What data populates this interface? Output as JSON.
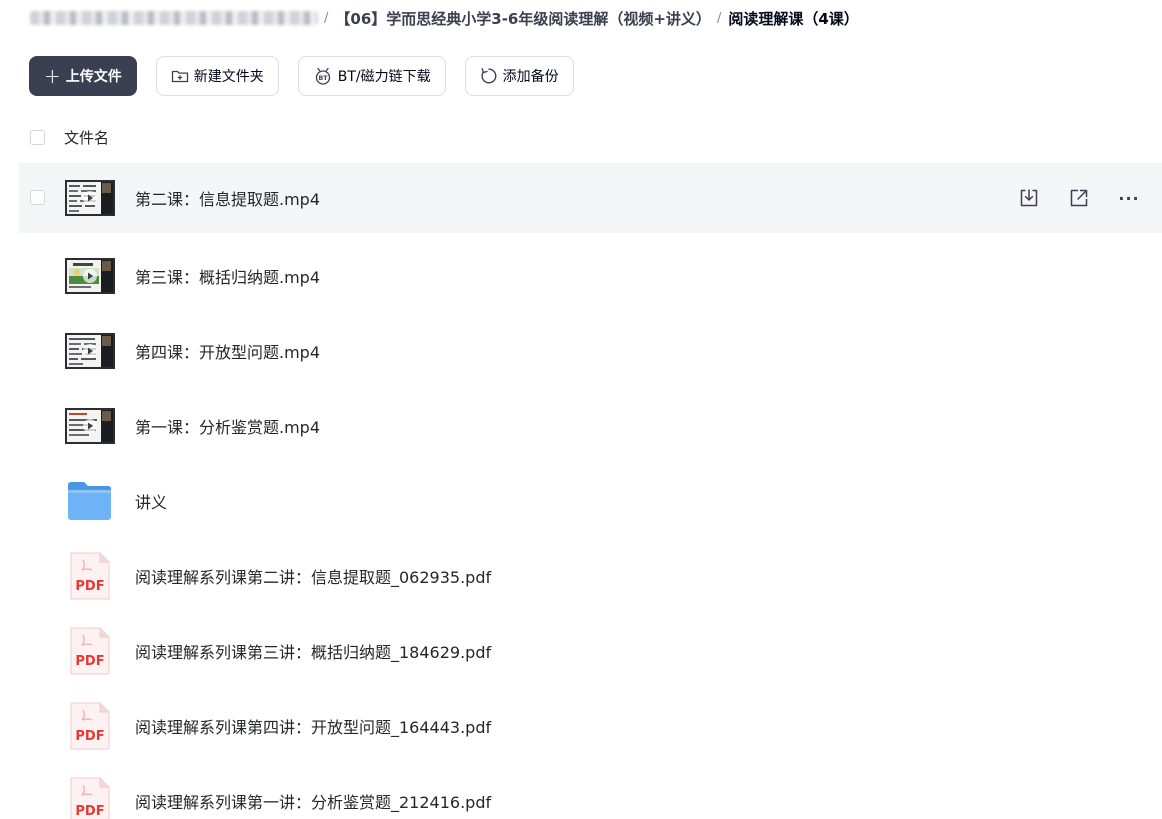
{
  "breadcrumb": {
    "parent": "【06】学而思经典小学3-6年级阅读理解（视频+讲义）",
    "current": "阅读理解课（4课）",
    "separator": "/"
  },
  "toolbar": {
    "upload_label": "上传文件",
    "new_folder_label": "新建文件夹",
    "bt_label": "BT/磁力链下载",
    "backup_label": "添加备份"
  },
  "list": {
    "column_header": "文件名",
    "files": [
      {
        "name": "第二课：信息提取题.mp4",
        "type": "video",
        "icon": "video-thumbnail"
      },
      {
        "name": "第三课：概括归纳题.mp4",
        "type": "video",
        "icon": "video-thumbnail"
      },
      {
        "name": "第四课：开放型问题.mp4",
        "type": "video",
        "icon": "video-thumbnail"
      },
      {
        "name": "第一课：分析鉴赏题.mp4",
        "type": "video",
        "icon": "video-thumbnail"
      },
      {
        "name": "讲义",
        "type": "folder",
        "icon": "folder-icon"
      },
      {
        "name": "阅读理解系列课第二讲：信息提取题_062935.pdf",
        "type": "pdf",
        "icon": "pdf-icon",
        "badge": "PDF"
      },
      {
        "name": "阅读理解系列课第三讲：概括归纳题_184629.pdf",
        "type": "pdf",
        "icon": "pdf-icon",
        "badge": "PDF"
      },
      {
        "name": "阅读理解系列课第四讲：开放型问题_164443.pdf",
        "type": "pdf",
        "icon": "pdf-icon",
        "badge": "PDF"
      },
      {
        "name": "阅读理解系列课第一讲：分析鉴赏题_212416.pdf",
        "type": "pdf",
        "icon": "pdf-icon",
        "badge": "PDF"
      }
    ]
  },
  "row_actions": {
    "icons": [
      "download-icon",
      "share-icon",
      "more-icon"
    ],
    "more_glyph": "···"
  },
  "colors": {
    "primary_button": "#3b3f52",
    "hover_row": "#f4f5f7",
    "pdf_red": "#e53935",
    "folder_blue": "#5ba8f0"
  }
}
